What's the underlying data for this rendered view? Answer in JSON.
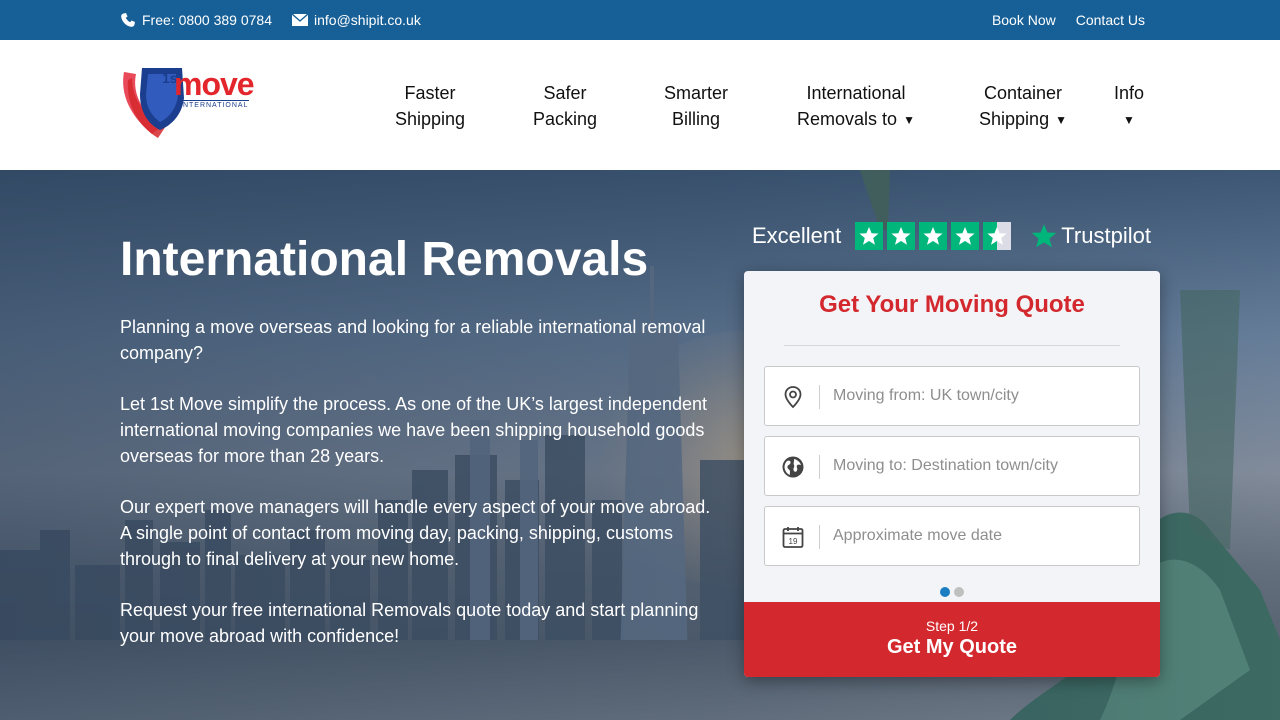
{
  "topbar": {
    "phone": "Free: 0800 389 0784",
    "email": "info@shipit.co.uk",
    "links": [
      "Book Now",
      "Contact Us"
    ]
  },
  "logo": {
    "sup": "1st",
    "brand": "move",
    "sub": "INTERNATIONAL"
  },
  "nav": [
    {
      "line1": "Faster",
      "line2": "Shipping",
      "dropdown": false
    },
    {
      "line1": "Safer",
      "line2": "Packing",
      "dropdown": false
    },
    {
      "line1": "Smarter",
      "line2": "Billing",
      "dropdown": false
    },
    {
      "line1": "International",
      "line2": "Removals to",
      "dropdown": true
    },
    {
      "line1": "Container",
      "line2": "Shipping",
      "dropdown": true
    },
    {
      "line1": "Info",
      "line2": "",
      "dropdown": true
    }
  ],
  "hero": {
    "title": "International Removals",
    "paragraphs": [
      "Planning a move overseas and looking for a reliable international removal company?",
      "Let 1st Move simplify the process. As one of the UK’s largest independent international moving companies we have been shipping household goods overseas for more than 28 years.",
      "Our expert move managers will handle every aspect of your move abroad. A single point of contact from moving day, packing, shipping, customs through to final delivery at your new home.",
      "Request your free international Removals quote today and start planning your move abroad with confidence!"
    ]
  },
  "trustpilot": {
    "rating_text": "Excellent",
    "stars": 4.5,
    "brand": "Trustpilot"
  },
  "quote_form": {
    "title": "Get Your Moving Quote",
    "fields": [
      {
        "icon": "location-pin-icon",
        "placeholder": "Moving from: UK town/city",
        "value": ""
      },
      {
        "icon": "globe-icon",
        "placeholder": "Moving to: Destination town/city",
        "value": ""
      },
      {
        "icon": "calendar-icon",
        "placeholder": "Approximate move date",
        "value": "",
        "calendar_day": "19"
      }
    ],
    "step_current": 1,
    "step_total": 2,
    "step_label": "Step 1/2",
    "submit_label": "Get My Quote"
  },
  "colors": {
    "topbar": "#176097",
    "accent_red": "#d3282d",
    "trustpilot_green": "#00b67a",
    "active_dot": "#1b7ec2"
  }
}
